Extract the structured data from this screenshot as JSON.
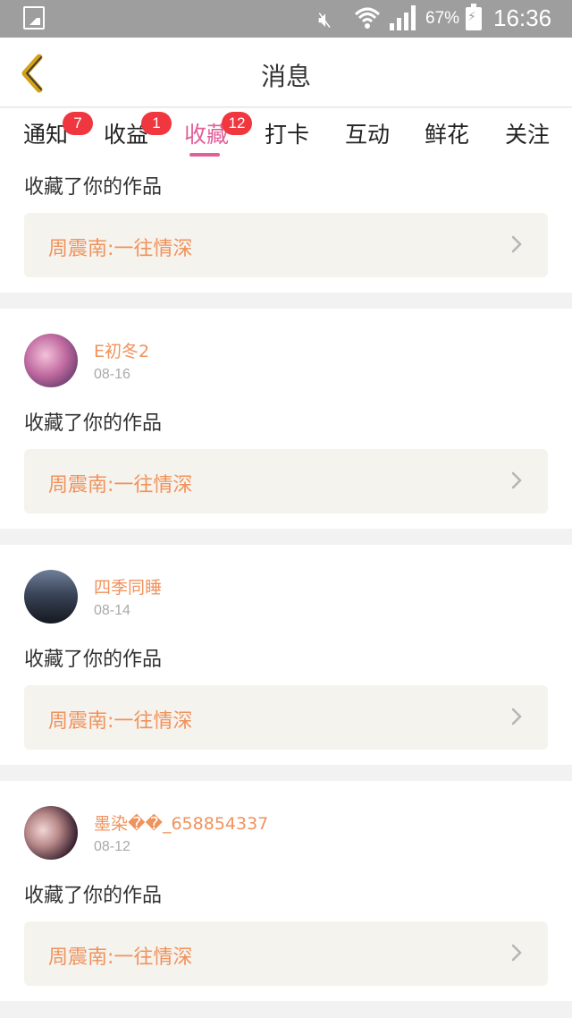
{
  "status_bar": {
    "battery": "67%",
    "time": "16:36",
    "icons": [
      "image-icon",
      "mute-icon",
      "wifi-icon",
      "signal-icon",
      "battery-charging-icon"
    ]
  },
  "header": {
    "title": "消息",
    "back_icon": "chevron-left-icon"
  },
  "tabs": [
    {
      "label": "通知",
      "badge": "7"
    },
    {
      "label": "收益",
      "badge": "1"
    },
    {
      "label": "收藏",
      "badge": "12",
      "active": true
    },
    {
      "label": "打卡"
    },
    {
      "label": "互动"
    },
    {
      "label": "鲜花"
    },
    {
      "label": "关注"
    }
  ],
  "items": [
    {
      "action": "收藏了你的作品",
      "work": "周震南:一往情深"
    },
    {
      "user": "E初冬2",
      "date": "08-16",
      "action": "收藏了你的作品",
      "work": "周震南:一往情深"
    },
    {
      "user": "四季同睡",
      "date": "08-14",
      "action": "收藏了你的作品",
      "work": "周震南:一往情深"
    },
    {
      "user": "墨染��_658854337",
      "date": "08-12",
      "action": "收藏了你的作品",
      "work": "周震南:一往情深"
    }
  ],
  "colors": {
    "accent_pink": "#e1609a",
    "username_orange": "#f0925c",
    "badge_red": "#f0363e",
    "status_bar": "#9e9e9e"
  }
}
